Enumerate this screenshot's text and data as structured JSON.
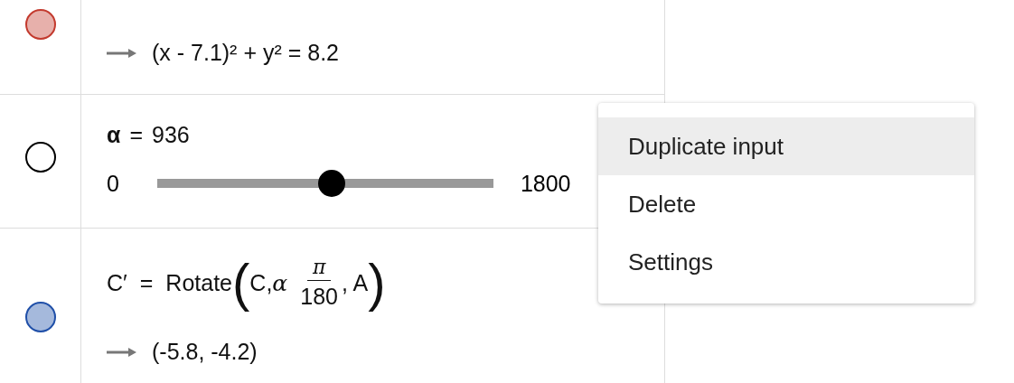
{
  "algebra_rows": [
    {
      "kind": "output",
      "visible": true,
      "color": "#c33a2e",
      "output": "(x - 7.1)² + y² = 8.2"
    },
    {
      "kind": "slider",
      "visible": false,
      "color": "#000000",
      "name": "α",
      "equals": "=",
      "value": "936",
      "min": "0",
      "max": "1800",
      "level": 0.52
    },
    {
      "kind": "formula",
      "visible": true,
      "color": "#1f4fa8",
      "lhs": "C′",
      "equals": "=",
      "function": "Rotate",
      "open": "(",
      "args": "C, ",
      "alpha": "α",
      "numerator": "π",
      "denominator": "180",
      "tail": ", A",
      "close": ")",
      "output": "(-5.8, -4.2)"
    }
  ],
  "context_menu": {
    "items": [
      {
        "label": "Duplicate input",
        "selected": true
      },
      {
        "label": "Delete",
        "selected": false
      },
      {
        "label": "Settings",
        "selected": false
      }
    ]
  }
}
